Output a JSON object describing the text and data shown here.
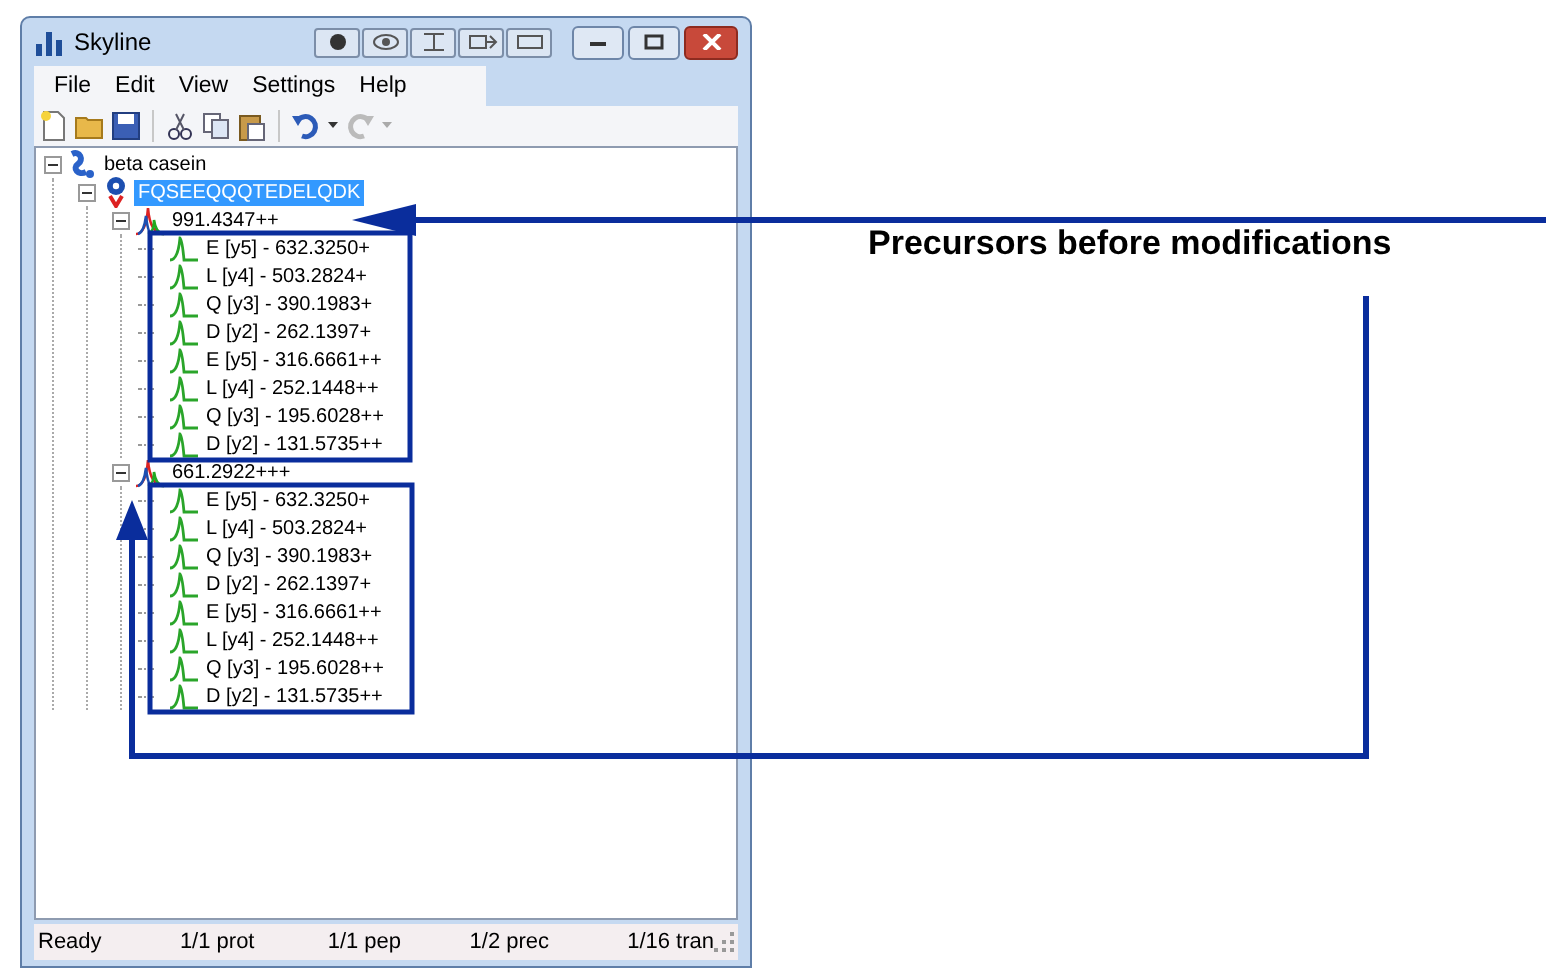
{
  "window": {
    "title": "Skyline"
  },
  "menu": [
    "File",
    "Edit",
    "View",
    "Settings",
    "Help"
  ],
  "tree": [
    {
      "kind": "protein",
      "label": "beta casein",
      "selected": false,
      "expanded": true,
      "children": [
        {
          "kind": "peptide",
          "label": "FQSEEQQQTEDELQDK",
          "selected": true,
          "expanded": true,
          "children": [
            {
              "kind": "precursor",
              "label": "991.4347++",
              "selected": false,
              "expanded": true,
              "children": [
                {
                  "kind": "transition",
                  "label": "E [y5] - 632.3250+",
                  "selected": false
                },
                {
                  "kind": "transition",
                  "label": "L [y4] - 503.2824+",
                  "selected": false
                },
                {
                  "kind": "transition",
                  "label": "Q [y3] - 390.1983+",
                  "selected": false
                },
                {
                  "kind": "transition",
                  "label": "D [y2] - 262.1397+",
                  "selected": false
                },
                {
                  "kind": "transition",
                  "label": "E [y5] - 316.6661++",
                  "selected": false
                },
                {
                  "kind": "transition",
                  "label": "L [y4] - 252.1448++",
                  "selected": false
                },
                {
                  "kind": "transition",
                  "label": "Q [y3] - 195.6028++",
                  "selected": false
                },
                {
                  "kind": "transition",
                  "label": "D [y2] - 131.5735++",
                  "selected": false
                }
              ]
            },
            {
              "kind": "precursor",
              "label": "661.2922+++",
              "selected": false,
              "expanded": true,
              "children": [
                {
                  "kind": "transition",
                  "label": "E [y5] - 632.3250+",
                  "selected": false
                },
                {
                  "kind": "transition",
                  "label": "L [y4] - 503.2824+",
                  "selected": false
                },
                {
                  "kind": "transition",
                  "label": "Q [y3] - 390.1983+",
                  "selected": false
                },
                {
                  "kind": "transition",
                  "label": "D [y2] - 262.1397+",
                  "selected": false
                },
                {
                  "kind": "transition",
                  "label": "E [y5] - 316.6661++",
                  "selected": false
                },
                {
                  "kind": "transition",
                  "label": "L [y4] - 252.1448++",
                  "selected": false
                },
                {
                  "kind": "transition",
                  "label": "Q [y3] - 195.6028++",
                  "selected": false
                },
                {
                  "kind": "transition",
                  "label": "D [y2] - 131.5735++",
                  "selected": false
                }
              ]
            }
          ]
        }
      ]
    }
  ],
  "status_bar": [
    "Ready",
    "1/1 prot",
    "1/1 pep",
    "1/2 prec",
    "1/16 tran"
  ],
  "annotation": {
    "label": "Precursors before modifications"
  }
}
